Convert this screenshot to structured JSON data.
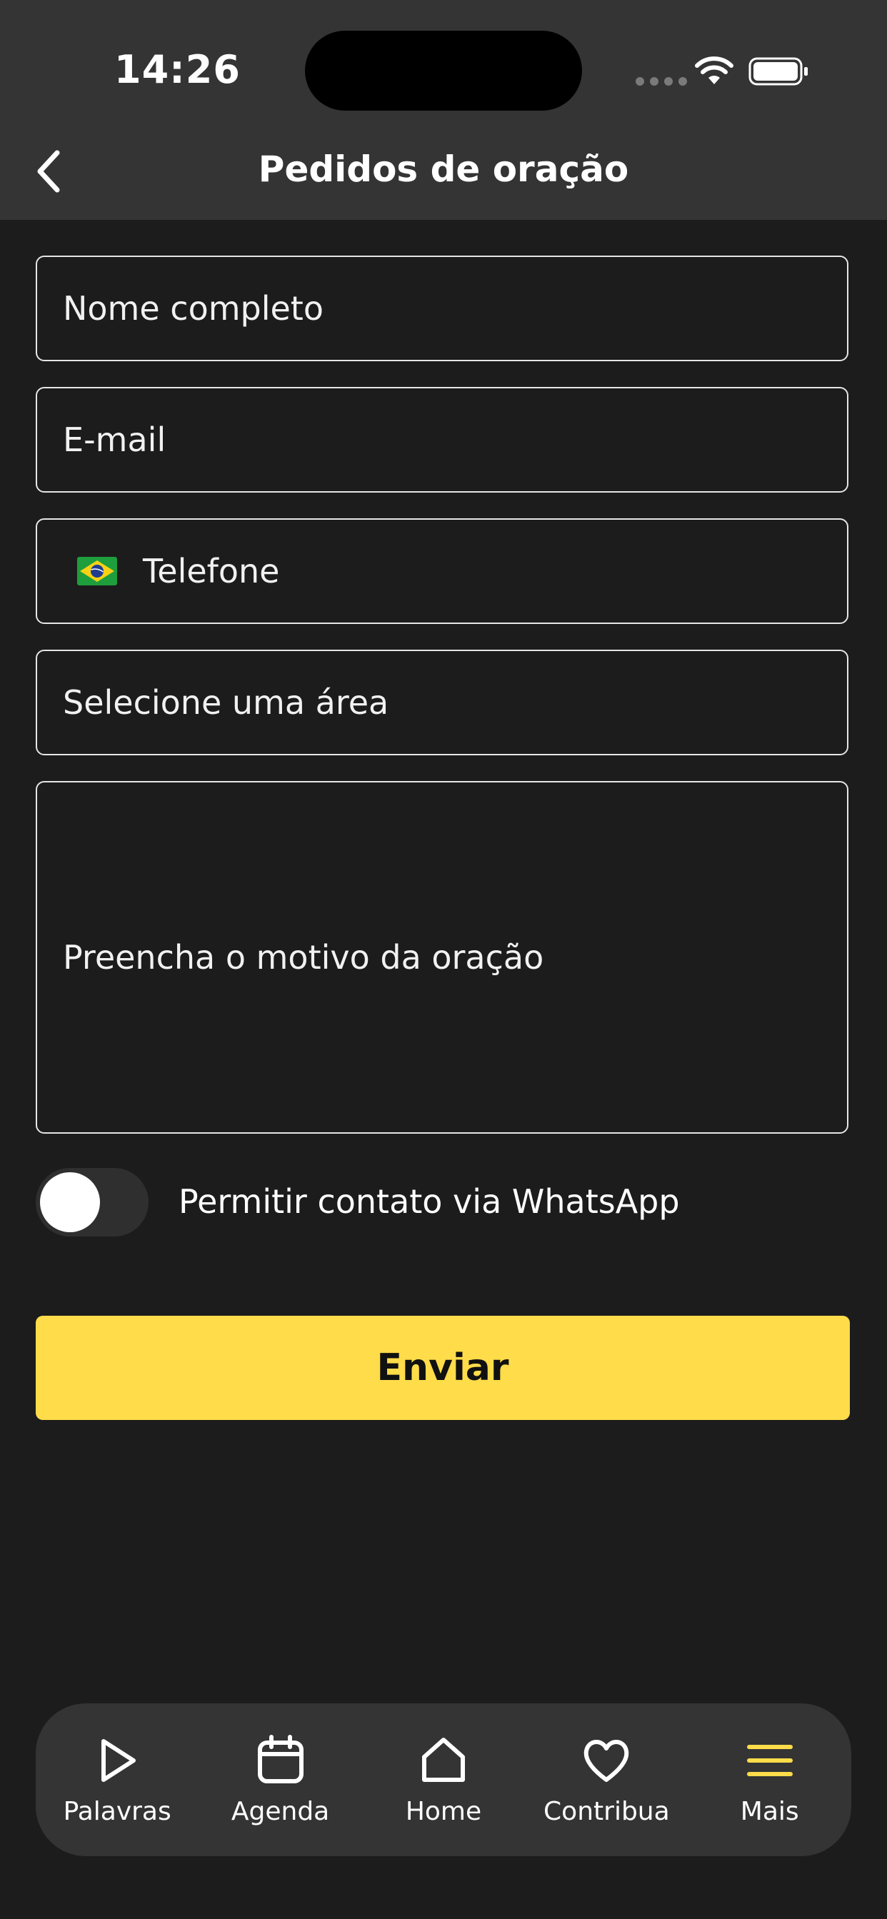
{
  "status_bar": {
    "time": "14:26"
  },
  "header": {
    "title": "Pedidos de oração"
  },
  "form": {
    "name_placeholder": "Nome completo",
    "email_placeholder": "E-mail",
    "phone_placeholder": "Telefone",
    "area_placeholder": "Selecione uma área",
    "reason_placeholder": "Preencha o motivo da oração",
    "whatsapp_toggle_label": "Permitir contato via WhatsApp",
    "whatsapp_toggle_on": false,
    "submit_label": "Enviar"
  },
  "tabbar": {
    "items": [
      {
        "label": "Palavras",
        "icon": "play-icon",
        "active": false
      },
      {
        "label": "Agenda",
        "icon": "calendar-icon",
        "active": false
      },
      {
        "label": "Home",
        "icon": "home-icon",
        "active": false
      },
      {
        "label": "Contribua",
        "icon": "heart-icon",
        "active": false
      },
      {
        "label": "Mais",
        "icon": "menu-icon",
        "active": true
      }
    ]
  },
  "colors": {
    "accent": "#ffdc4a",
    "background": "#1c1c1c",
    "header": "#343434"
  }
}
